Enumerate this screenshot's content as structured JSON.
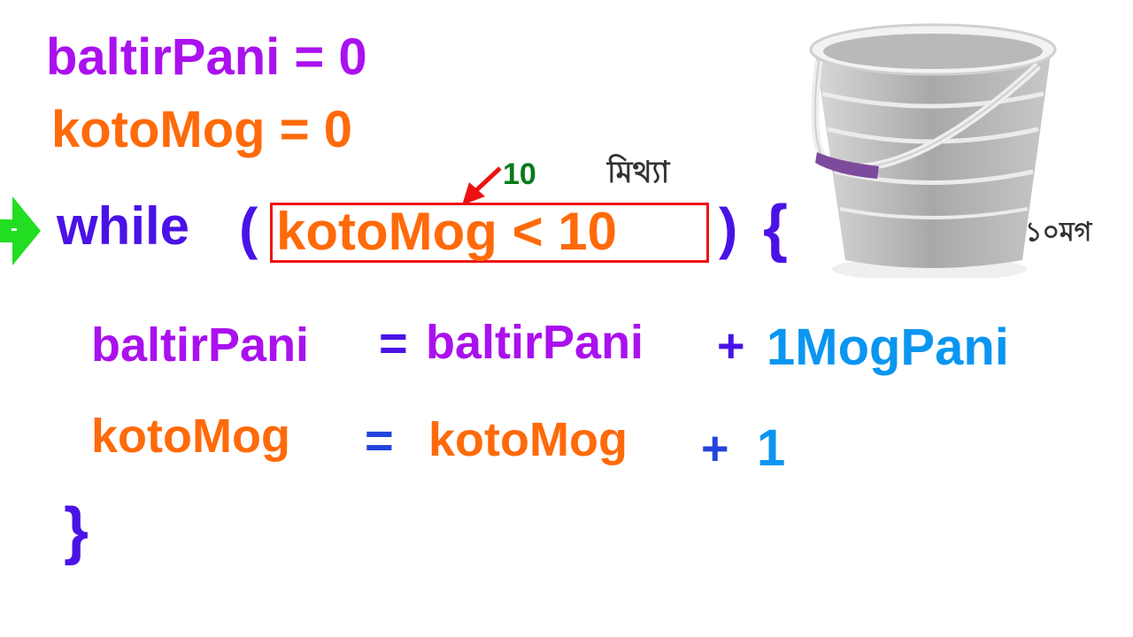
{
  "lines": {
    "init_pani": "baltirPani = 0",
    "init_mog": "kotoMog = 0",
    "while_kw": "while",
    "open_paren": "(",
    "condition": "kotoMog < 10",
    "close_paren": ")",
    "open_brace": "{",
    "body_pani_lhs": "baltirPani",
    "body_pani_eq": "=",
    "body_pani_rhs": "baltirPani",
    "body_pani_plus": "+",
    "body_pani_add": "1MogPani",
    "body_mog_lhs": "kotoMog",
    "body_mog_eq": "=",
    "body_mog_rhs": "kotoMog",
    "body_mog_plus": "+",
    "body_mog_add": "1",
    "close_brace": "}"
  },
  "annotations": {
    "current_value": "10",
    "result_label": "মিথ্যা",
    "bucket_label": "১০মগ",
    "pointer_symbol": "-"
  },
  "colors": {
    "variable_pani": "#aa11ee",
    "variable_mog": "#ff6a0a",
    "keyword": "#4a12e6",
    "literal": "#0a96f0",
    "highlight_box": "#ee1111",
    "pointer_arrow": "#22dd22",
    "value_label": "#0a7a1a"
  },
  "icons": [
    "green-pointer-arrow-icon",
    "red-arrow-icon",
    "bucket-icon"
  ]
}
